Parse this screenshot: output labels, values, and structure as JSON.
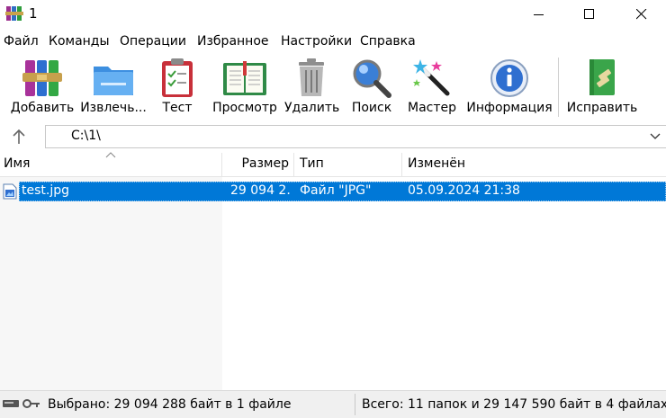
{
  "window": {
    "title": "1"
  },
  "menu": [
    "Файл",
    "Команды",
    "Операции",
    "Избранное",
    "Настройки",
    "Справка"
  ],
  "toolbar": {
    "add": "Добавить",
    "extract": "Извлечь...",
    "test": "Тест",
    "view": "Просмотр",
    "delete": "Удалить",
    "find": "Поиск",
    "wizard": "Мастер",
    "info": "Информация",
    "repair": "Исправить"
  },
  "address": {
    "path": "C:\\1\\"
  },
  "columns": {
    "name": "Имя",
    "size": "Размер",
    "type": "Тип",
    "modified": "Изменён"
  },
  "files": [
    {
      "name": "test.jpg",
      "size": "29 094 2...",
      "type": "Файл \"JPG\"",
      "modified": "05.09.2024 21:38",
      "selected": true
    }
  ],
  "status": {
    "left": "Выбрано: 29 094 288 байт в 1 файле",
    "right": "Всего: 11 папок и 29 147 590 байт в 4 файлах"
  },
  "colors": {
    "selection": "#0078d7",
    "status_bg": "#f0f0f0"
  }
}
